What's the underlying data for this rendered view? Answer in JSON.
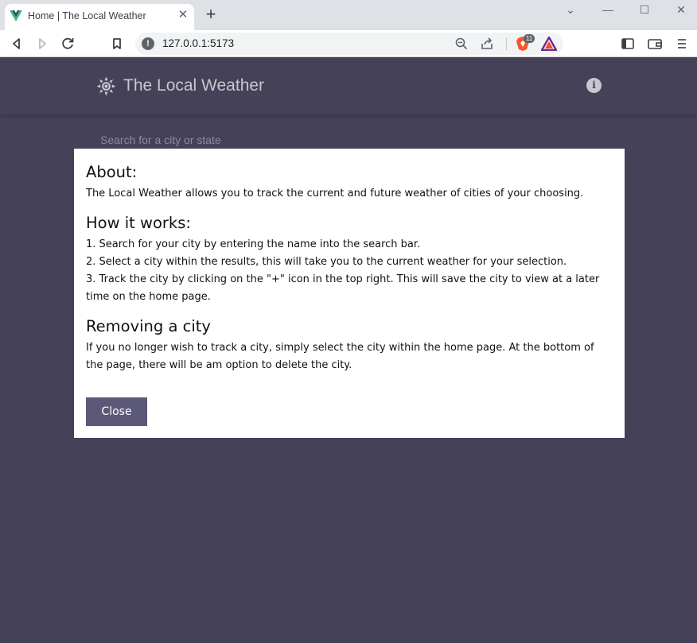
{
  "browser": {
    "tab_title": "Home | The Local Weather",
    "tab_close": "✕",
    "new_tab": "+",
    "url": "127.0.0.1:5173",
    "brave_badge": "11",
    "window_controls": {
      "chevron": "⌄",
      "minimize": "—",
      "maximize": "☐",
      "close": "✕"
    }
  },
  "header": {
    "title": "The Local Weather",
    "logo_icon": "sun-icon",
    "about_icon": "i"
  },
  "search": {
    "placeholder": "Search for a city or state",
    "value": ""
  },
  "modal": {
    "sections": [
      {
        "heading": "About:",
        "lines": [
          "The Local Weather allows you to track the current and future weather of cities of your choosing."
        ]
      },
      {
        "heading": "How it works:",
        "lines": [
          "1. Search for your city by entering the name into the search bar.",
          "2. Select a city within the results, this will take you to the current weather for your selection.",
          "3. Track the city by clicking on the \"+\" icon in the top right. This will save the city to view at a later time on the home page."
        ]
      },
      {
        "heading": "Removing a city",
        "lines": [
          "If you no longer wish to track a city, simply select the city within the home page. At the bottom of the page, there will be am option to delete the city."
        ]
      }
    ],
    "close_label": "Close"
  },
  "colors": {
    "app_background": "#454158",
    "button": "#5c587a",
    "modal_background": "#ffffff"
  }
}
